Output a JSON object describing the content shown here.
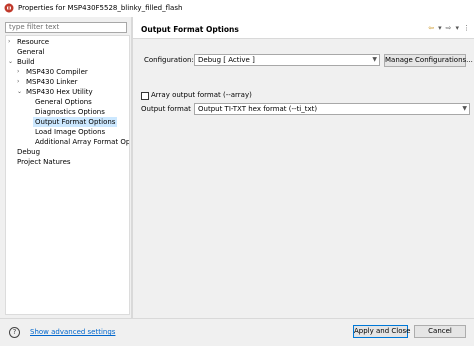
{
  "window": {
    "title": "Properties for MSP430F5528_blinky_filled_flash",
    "app_icon": "ccs-app-icon",
    "accent_color": "#c0392b"
  },
  "sidebar": {
    "filter_placeholder": "type filter text",
    "items": [
      {
        "label": "Resource",
        "expandable": true,
        "expanded": false,
        "level": 0
      },
      {
        "label": "General",
        "expandable": false,
        "level": 0
      },
      {
        "label": "Build",
        "expandable": true,
        "expanded": true,
        "level": 0
      },
      {
        "label": "MSP430 Compiler",
        "expandable": true,
        "expanded": false,
        "level": 1
      },
      {
        "label": "MSP430 Linker",
        "expandable": true,
        "expanded": false,
        "level": 1
      },
      {
        "label": "MSP430 Hex Utility",
        "expandable": true,
        "expanded": true,
        "level": 1
      },
      {
        "label": "General Options",
        "level": 2
      },
      {
        "label": "Diagnostics Options",
        "level": 2
      },
      {
        "label": "Output Format Options",
        "level": 2,
        "selected": true
      },
      {
        "label": "Load Image Options",
        "level": 2
      },
      {
        "label": "Additional Array Format Option",
        "level": 2
      },
      {
        "label": "Debug",
        "expandable": false,
        "level": 0
      },
      {
        "label": "Project Natures",
        "expandable": false,
        "level": 0
      }
    ]
  },
  "page": {
    "title": "Output Format Options",
    "configuration_label": "Configuration:",
    "configuration_value": "Debug  [ Active ]",
    "manage_button": "Manage Configurations...",
    "array_checkbox_label": "Array output format (--array)",
    "array_checked": false,
    "output_format_label": "Output format",
    "output_format_value": "Output TI-TXT hex format (--ti_txt)"
  },
  "footer": {
    "help_icon": "?",
    "show_advanced": "Show advanced settings",
    "apply_close": "Apply and Close",
    "cancel": "Cancel"
  }
}
